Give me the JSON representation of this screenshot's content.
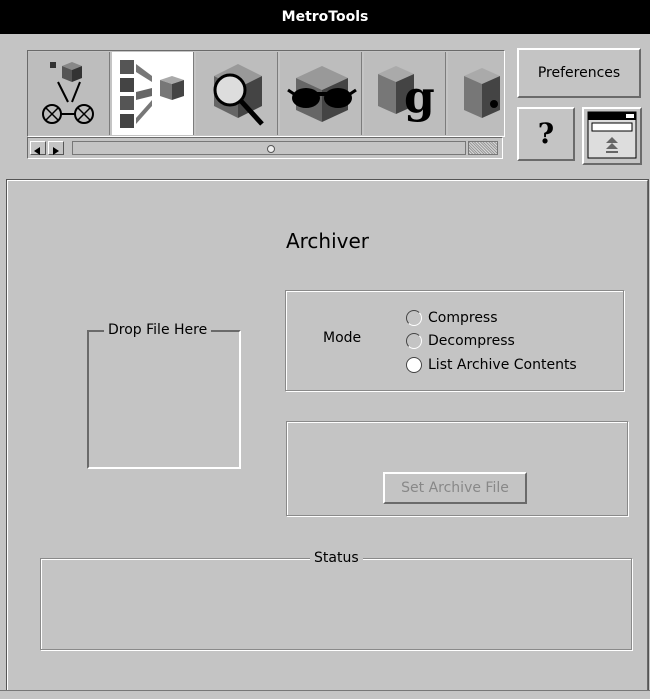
{
  "window": {
    "title": "MetroTools"
  },
  "toolbar": {
    "tools": [
      {
        "name": "robot-tool-icon"
      },
      {
        "name": "archiver-tool-icon",
        "selected": true
      },
      {
        "name": "search-tool-icon"
      },
      {
        "name": "sunglasses-tool-icon"
      },
      {
        "name": "g-tool-icon"
      },
      {
        "name": "cube-tool-icon"
      }
    ],
    "preferences_label": "Preferences",
    "help_label": "?"
  },
  "archiver": {
    "title": "Archiver",
    "drop_label": "Drop File Here",
    "mode_label": "Mode",
    "modes": [
      {
        "label": "Compress",
        "selected": false
      },
      {
        "label": "Decompress",
        "selected": false
      },
      {
        "label": "List Archive Contents",
        "selected": true
      }
    ],
    "set_archive_label": "Set Archive File",
    "status_label": "Status",
    "status_text": ""
  }
}
